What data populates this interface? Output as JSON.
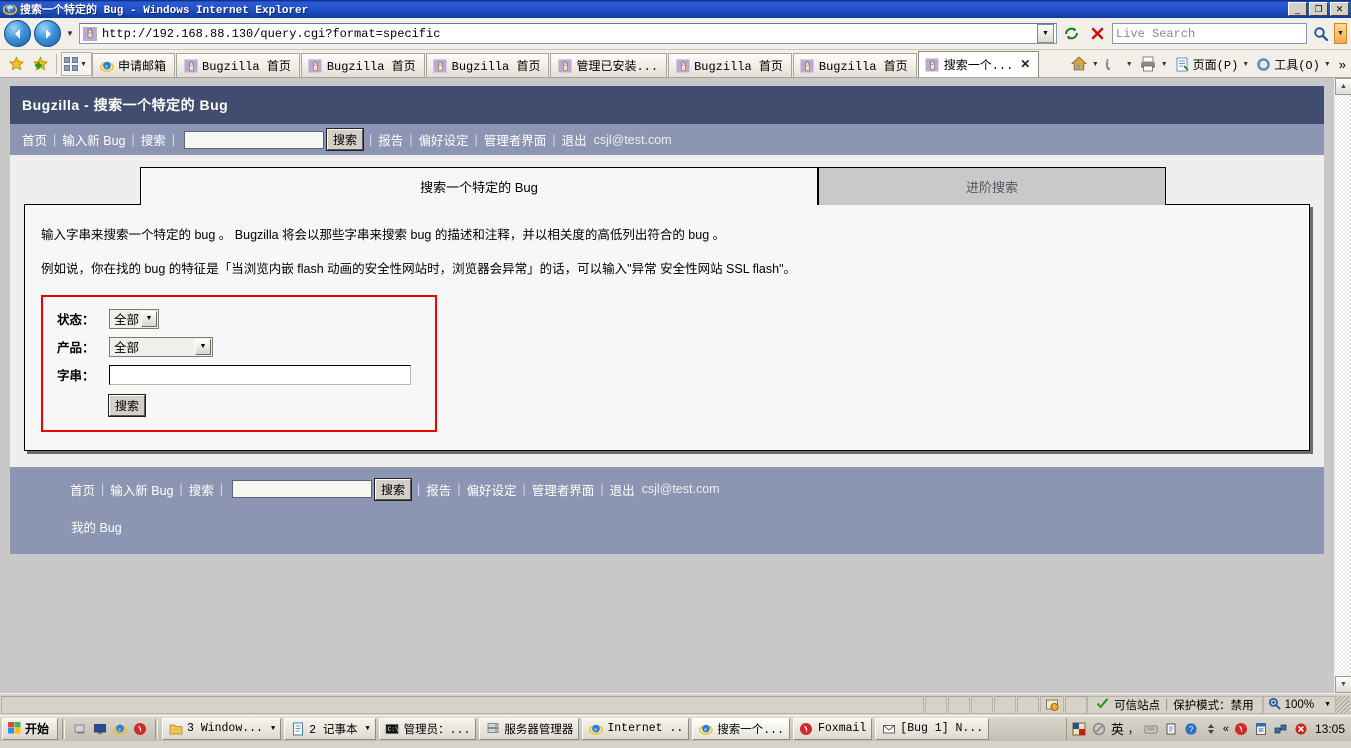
{
  "window": {
    "title": "搜索一个特定的 Bug - Windows Internet Explorer",
    "icon": "ie-logo-icon",
    "minimize": "_",
    "maximize": "❐",
    "close": "✕"
  },
  "address_bar": {
    "back": "back-arrow",
    "forward": "forward-arrow",
    "history_caret": "▼",
    "url": "http://192.168.88.130/query.cgi?format=specific",
    "url_dropdown": "▼",
    "refresh": "refresh-icon",
    "stop": "stop-icon",
    "search_placeholder": "Live Search",
    "search_go": "search-icon",
    "search_caret": "▼"
  },
  "tab_bar": {
    "favorites_icon": "star-icon",
    "add_favorites_icon": "add-star-icon",
    "quick_tabs_caret": "▼",
    "tabs": [
      {
        "label": "申请邮箱",
        "icon": "ie-page-icon",
        "active": false,
        "closable": false
      },
      {
        "label": "Bugzilla 首页",
        "icon": "bugzilla-icon",
        "active": false,
        "closable": false
      },
      {
        "label": "Bugzilla 首页",
        "icon": "bugzilla-icon",
        "active": false,
        "closable": false
      },
      {
        "label": "Bugzilla 首页",
        "icon": "bugzilla-icon",
        "active": false,
        "closable": false
      },
      {
        "label": "管理已安装...",
        "icon": "bugzilla-icon",
        "active": false,
        "closable": false
      },
      {
        "label": "Bugzilla 首页",
        "icon": "bugzilla-icon",
        "active": false,
        "closable": false
      },
      {
        "label": "Bugzilla 首页",
        "icon": "bugzilla-icon",
        "active": false,
        "closable": false
      },
      {
        "label": "搜索一个...",
        "icon": "bugzilla-icon",
        "active": true,
        "closable": true,
        "close": "✕"
      }
    ],
    "right_items": [
      {
        "label": "",
        "icon": "home-icon",
        "caret": "▼"
      },
      {
        "label": "",
        "icon": "rss-icon",
        "caret": "▼"
      },
      {
        "label": "",
        "icon": "print-icon",
        "caret": "▼"
      },
      {
        "label": "页面(P)",
        "icon": "page-icon",
        "caret": "▼"
      },
      {
        "label": "工具(O)",
        "icon": "tools-icon",
        "caret": "▼"
      }
    ],
    "overflow": "»"
  },
  "bugzilla": {
    "header_title": "Bugzilla - 搜索一个特定的 Bug",
    "nav": {
      "links_before": [
        "首页",
        "输入新 Bug",
        "搜索"
      ],
      "search_value": "",
      "search_button": "搜索",
      "links_after": [
        "报告",
        "偏好设定",
        "管理者界面",
        "退出"
      ],
      "user_email": "csjl@test.com",
      "separator": "|"
    },
    "tabs": [
      {
        "label": "搜索一个特定的 Bug",
        "selected": true
      },
      {
        "label": "进阶搜索",
        "selected": false
      }
    ],
    "paragraphs": [
      "输入字串来搜索一个特定的 bug 。 Bugzilla 将会以那些字串来搜索 bug 的描述和注释，并以相关度的高低列出符合的 bug 。",
      "例如说，你在找的 bug 的特征是「当浏览内嵌 flash 动画的安全性网站时，浏览器会异常」的话，可以输入\"异常 安全性网站 SSL flash\"。"
    ],
    "form": {
      "fields": [
        {
          "label": "状态：",
          "type": "select",
          "value": "全部",
          "caret": "▼",
          "name": "status-select"
        },
        {
          "label": "产品：",
          "type": "select",
          "value": "全部",
          "caret": "▼",
          "name": "product-select"
        },
        {
          "label": "字串：",
          "type": "text",
          "value": "",
          "name": "content-input"
        }
      ],
      "submit": "搜索"
    },
    "footer": {
      "links_before": [
        "首页",
        "输入新 Bug",
        "搜索"
      ],
      "search_value": "",
      "search_button": "搜索",
      "links_after": [
        "报告",
        "偏好设定",
        "管理者界面",
        "退出"
      ],
      "user_email": "csjl@test.com",
      "my_bugs": "我的 Bug",
      "separator": "|"
    }
  },
  "status_bar": {
    "security_icon": "shield-warning-icon",
    "check_icon": "green-check-icon",
    "zone": "可信站点",
    "zone_separator": "|",
    "protected_mode": "保护模式：禁用",
    "zoom_icon": "zoom-icon",
    "zoom_level": "100%",
    "zoom_caret": "▼"
  },
  "taskbar": {
    "start": "开始",
    "start_icon": "windows-flag-icon",
    "quick_launch": [
      "show-desktop-icon",
      "monitor-icon",
      "ie-icon",
      "foxmail-icon"
    ],
    "items": [
      {
        "label": "3 Window...",
        "icon": "folder-icon",
        "caret": "▼"
      },
      {
        "label": "2 记事本",
        "icon": "notepad-icon",
        "caret": "▼"
      },
      {
        "label": "管理员：...",
        "icon": "cmd-icon",
        "caret": ""
      },
      {
        "label": "服务器管理器",
        "icon": "server-icon",
        "caret": ""
      },
      {
        "label": "Internet ..",
        "icon": "ie-icon",
        "caret": ""
      },
      {
        "label": "搜索一个...",
        "icon": "ie-icon",
        "caret": "",
        "active": true
      },
      {
        "label": "Foxmail",
        "icon": "foxmail-icon",
        "caret": ""
      },
      {
        "label": "[Bug 1] N...",
        "icon": "mail-icon",
        "caret": ""
      }
    ],
    "tray": {
      "ime_icon": "ime-icon",
      "block_icon": "block-icon",
      "ime_label": "英",
      "comma": "，",
      "icons": [
        "keyboard-icon",
        "clipboard-icon",
        "help-icon",
        "updown-icon"
      ],
      "overflow": "«",
      "more_icons": [
        "mail-red-icon",
        "blue-doc-icon",
        "network-icon",
        "error-icon"
      ],
      "clock": "13:05"
    }
  },
  "annotation": {
    "arrow_color": "#f42020",
    "arrow_name": "red-pointer-arrow"
  },
  "colors": {
    "bz_header": "#404d6e",
    "bz_nav": "#8c96b2",
    "form_border": "#ee0000",
    "tab_selected_bg": "#f7f7f7",
    "tab_unselected_bg": "#c9c9c9"
  }
}
